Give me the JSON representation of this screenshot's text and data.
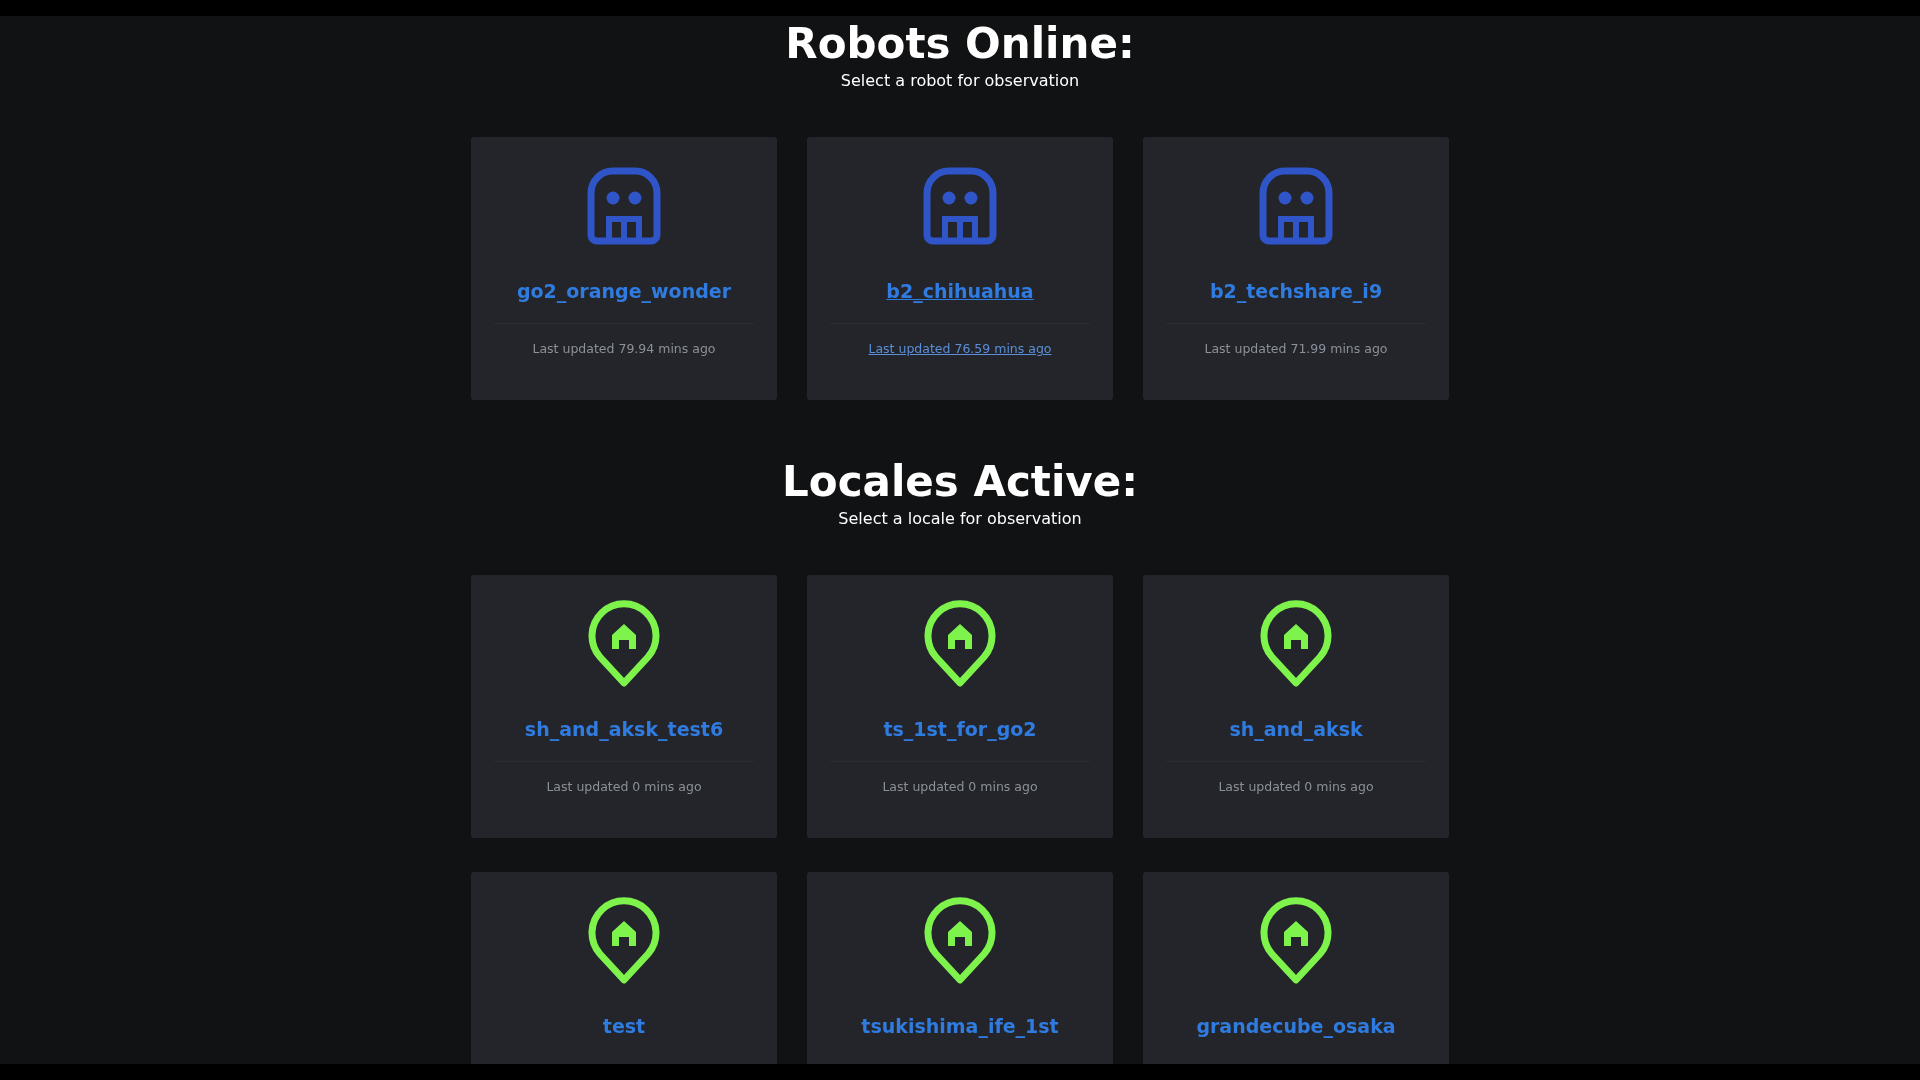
{
  "sections": [
    {
      "kind": "robot",
      "title": "Robots Online:",
      "subtitle": "Select a robot for observation",
      "cards": [
        {
          "name": "go2_orange_wonder",
          "updated": "Last updated 79.94 mins ago",
          "hovered": false
        },
        {
          "name": "b2_chihuahua",
          "updated": "Last updated 76.59 mins ago",
          "hovered": true
        },
        {
          "name": "b2_techshare_i9",
          "updated": "Last updated 71.99 mins ago",
          "hovered": false
        }
      ]
    },
    {
      "kind": "locale",
      "title": "Locales Active:",
      "subtitle": "Select a locale for observation",
      "cards": [
        {
          "name": "sh_and_aksk_test6",
          "updated": "Last updated 0 mins ago",
          "hovered": false
        },
        {
          "name": "ts_1st_for_go2",
          "updated": "Last updated 0 mins ago",
          "hovered": false
        },
        {
          "name": "sh_and_aksk",
          "updated": "Last updated 0 mins ago",
          "hovered": false
        },
        {
          "name": "test",
          "hovered": false
        },
        {
          "name": "tsukishima_ife_1st",
          "hovered": false
        },
        {
          "name": "grandecube_osaka",
          "hovered": false
        }
      ]
    }
  ]
}
